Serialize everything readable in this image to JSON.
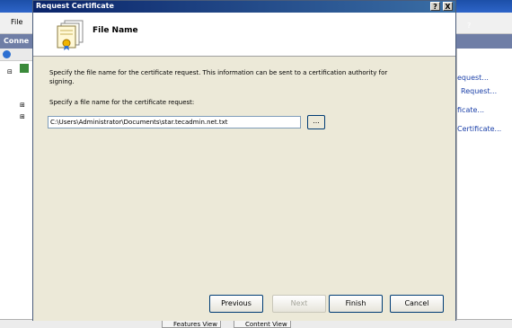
{
  "background": {
    "menu_file": "File",
    "connections_header": "Conne",
    "actions": [
      "equest...",
      "Request...",
      "ficate...",
      "Certificate..."
    ],
    "tabs": [
      "Features View",
      "Content View"
    ]
  },
  "dialog": {
    "title": "Request Certificate",
    "help_button": "?",
    "close_button": "X",
    "header_title": "File Name",
    "description": "Specify the file name for the certificate request. This information can be sent to a certification authority for signing.",
    "path_label": "Specify a file name for the certificate request:",
    "path_value": "C:\\Users\\Administrator\\Documents\\star.tecadmin.net.txt",
    "browse_label": "...",
    "buttons": {
      "previous": "Previous",
      "next": "Next",
      "finish": "Finish",
      "cancel": "Cancel"
    }
  }
}
